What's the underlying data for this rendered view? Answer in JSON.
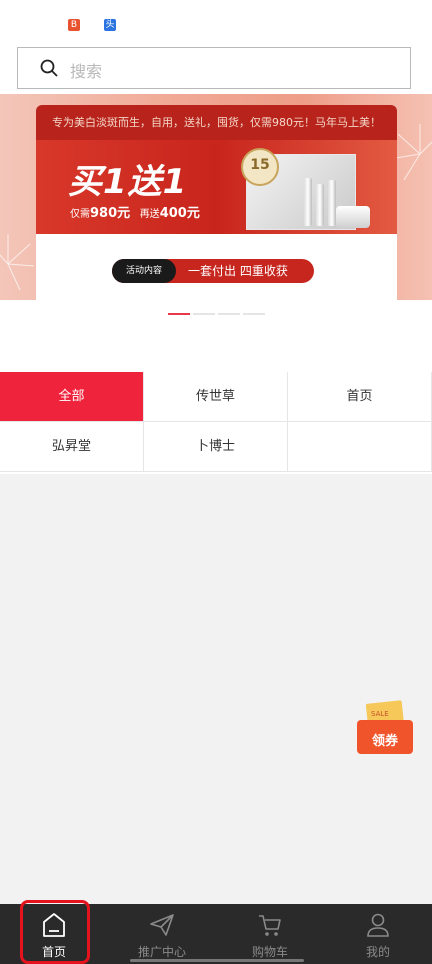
{
  "header": {
    "mini_icons": [
      {
        "label": "B",
        "color": "#e8522e"
      },
      {
        "label": "头",
        "color": "#2b73e0"
      }
    ],
    "search": {
      "placeholder": "搜索"
    }
  },
  "banner": {
    "top_text": "专为美白淡斑而生，自用，送礼，囤货，仅需980元！马年马上美！",
    "headline": "买1送1",
    "price_line_1": "仅需",
    "price_1": "980元",
    "price_line_2": "再送",
    "price_2": "400元",
    "badge": "15",
    "pill_tag": "活动内容",
    "pill_text": "一套付出 四重收获",
    "slides_total": 4,
    "active_slide": 1
  },
  "categories": [
    {
      "label": "全部",
      "active": true
    },
    {
      "label": "传世草",
      "active": false
    },
    {
      "label": "首页",
      "active": false
    },
    {
      "label": "弘昇堂",
      "active": false
    },
    {
      "label": "卜博士",
      "active": false
    },
    {
      "label": "",
      "active": false
    }
  ],
  "coupon": {
    "label": "领券",
    "sale": "SALE"
  },
  "tabbar": {
    "items": [
      {
        "label": "首页",
        "icon": "home-icon",
        "active": true
      },
      {
        "label": "推广中心",
        "icon": "paper-plane-icon",
        "active": false
      },
      {
        "label": "购物车",
        "icon": "cart-icon",
        "active": false
      },
      {
        "label": "我的",
        "icon": "user-icon",
        "active": false
      }
    ]
  },
  "colors": {
    "accent": "#f0233c",
    "tabbar_bg": "#2a2a2a",
    "highlight": "#e5131d"
  }
}
